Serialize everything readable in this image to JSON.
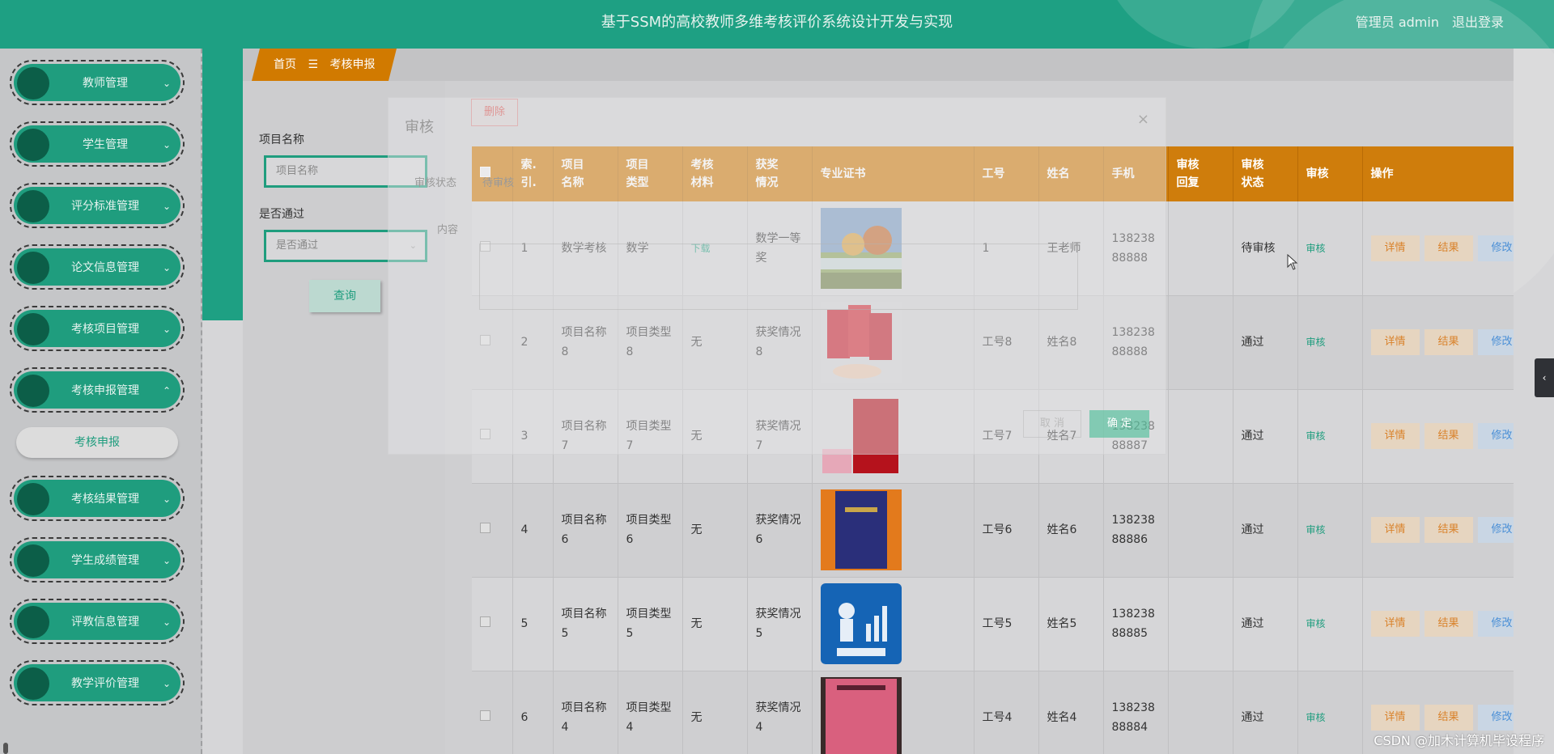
{
  "header": {
    "title": "基于SSM的高校教师多维考核评价系统设计开发与实现",
    "user": "管理员 admin",
    "logout": "退出登录"
  },
  "sidebar": {
    "items": [
      {
        "label": "教师管理",
        "chevron": "⌄"
      },
      {
        "label": "学生管理",
        "chevron": "⌄"
      },
      {
        "label": "评分标准管理",
        "chevron": "⌄"
      },
      {
        "label": "论文信息管理",
        "chevron": "⌄"
      },
      {
        "label": "考核项目管理",
        "chevron": "⌄"
      },
      {
        "label": "考核申报管理",
        "chevron": "⌃"
      },
      {
        "label": "考核结果管理",
        "chevron": "⌄"
      },
      {
        "label": "学生成绩管理",
        "chevron": "⌄"
      },
      {
        "label": "评教信息管理",
        "chevron": "⌄"
      },
      {
        "label": "教学评价管理",
        "chevron": "⌄"
      }
    ],
    "submenu": "考核申报"
  },
  "breadcrumb": {
    "home": "首页",
    "sep": "☰",
    "current": "考核申报"
  },
  "search": {
    "name_label": "项目名称",
    "name_placeholder": "项目名称",
    "pass_label": "是否通过",
    "pass_placeholder": "是否通过",
    "query_btn": "查询"
  },
  "toolbar": {
    "delete_btn": "删除"
  },
  "table": {
    "headers": {
      "index": "索.\n引.",
      "name": "项目\n名称",
      "type": "项目\n类型",
      "material": "考核\n材料",
      "award": "获奖\n情况",
      "cert": "专业证书",
      "empno": "工号",
      "person": "姓名",
      "phone": "手机",
      "reply": "审核\n回复",
      "status": "审核\n状态",
      "audit": "审核",
      "ops": "操作"
    },
    "rows": [
      {
        "index": "1",
        "name": "数学考核",
        "type": "数学",
        "material": "下载",
        "award": "数学一等奖",
        "empno": "1",
        "person": "王老师",
        "phone": "13823888888",
        "reply": "",
        "status": "待审核",
        "audit": "审核"
      },
      {
        "index": "2",
        "name": "项目名称8",
        "type": "项目类型8",
        "material": "无",
        "award": "获奖情况8",
        "empno": "工号8",
        "person": "姓名8",
        "phone": "13823888888",
        "reply": "",
        "status": "通过",
        "audit": "审核"
      },
      {
        "index": "3",
        "name": "项目名称7",
        "type": "项目类型7",
        "material": "无",
        "award": "获奖情况7",
        "empno": "工号7",
        "person": "姓名7",
        "phone": "13823888887",
        "reply": "",
        "status": "通过",
        "audit": "审核"
      },
      {
        "index": "4",
        "name": "项目名称6",
        "type": "项目类型6",
        "material": "无",
        "award": "获奖情况6",
        "empno": "工号6",
        "person": "姓名6",
        "phone": "13823888886",
        "reply": "",
        "status": "通过",
        "audit": "审核"
      },
      {
        "index": "5",
        "name": "项目名称5",
        "type": "项目类型5",
        "material": "无",
        "award": "获奖情况5",
        "empno": "工号5",
        "person": "姓名5",
        "phone": "13823888885",
        "reply": "",
        "status": "通过",
        "audit": "审核"
      },
      {
        "index": "6",
        "name": "项目名称4",
        "type": "项目类型4",
        "material": "无",
        "award": "获奖情况4",
        "empno": "工号4",
        "person": "姓名4",
        "phone": "13823888884",
        "reply": "",
        "status": "通过",
        "audit": "审核"
      }
    ],
    "op_detail": "详情",
    "op_result": "结果",
    "op_edit": "修改"
  },
  "modal": {
    "title": "审核",
    "close": "×",
    "status_label": "审核状态",
    "status_value": "待审核",
    "content_label": "内容",
    "cancel": "取 消",
    "confirm": "确 定"
  },
  "watermark": "CSDN @加木计算机毕设程序",
  "colors": {
    "primary": "#1ea083",
    "accent": "#cf7d0c",
    "danger": "#d9534f",
    "edit": "#4a8fd6"
  }
}
